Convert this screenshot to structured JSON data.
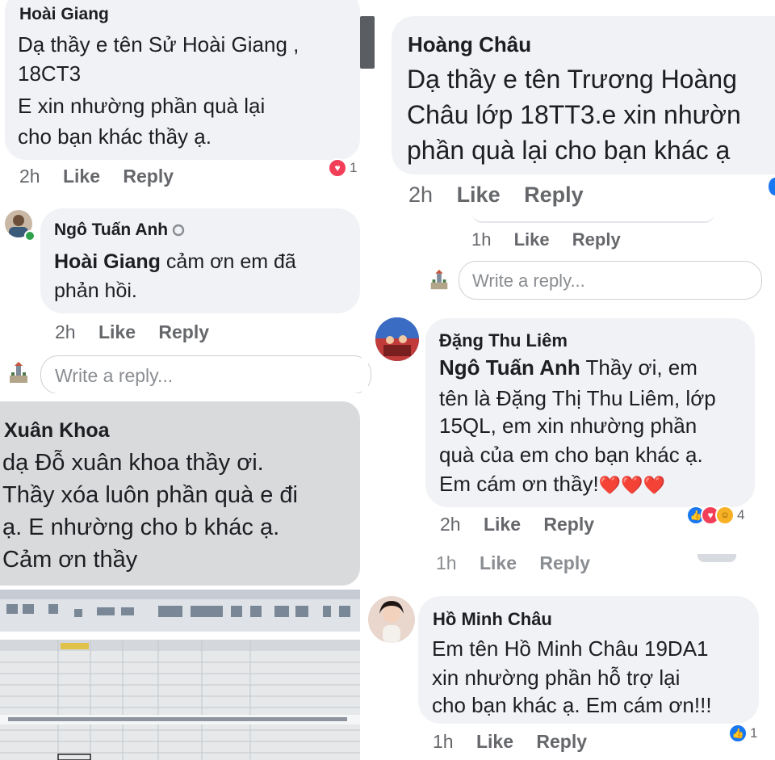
{
  "panel1": {
    "author": "Hoài Giang",
    "text_lines": [
      "Dạ thầy e tên Sử Hoài Giang ,",
      "18CT3",
      "E xin nhường phần quà lại",
      "cho bạn khác thầy ạ."
    ],
    "time": "2h",
    "like": "Like",
    "reply": "Reply",
    "reaction_count": "1",
    "reply_comment": {
      "author": "Ngô Tuấn Anh",
      "mention": "Hoài Giang",
      "text_line1": " cảm ơn em đã",
      "text_line2": "phản hồi.",
      "time": "2h",
      "like": "Like",
      "reply": "Reply"
    },
    "write_reply_placeholder": "Write a reply..."
  },
  "panel2": {
    "author": "Xuân Khoa",
    "text_lines": [
      "dạ Đỗ xuân khoa thầy ơi.",
      "Thầy xóa luôn phần quà e đi",
      "ạ. E nhường cho b khác ạ.",
      "Cảm ơn thầy"
    ]
  },
  "panel3": {
    "author": "Hoàng Châu",
    "text_lines": [
      "Dạ thầy e tên Trương Hoàng",
      "Châu lớp 18TT3.e xin nhườn",
      "phần quà lại cho bạn khác ạ"
    ],
    "time": "2h",
    "like": "Like",
    "reply": "Reply",
    "sub_meta": {
      "time": "1h",
      "like": "Like",
      "reply": "Reply"
    },
    "write_reply_placeholder": "Write a reply..."
  },
  "panel4": {
    "author": "Đặng Thu Liêm",
    "mention": "Ngô Tuấn Anh",
    "text_line1": " Thầy ơi, em",
    "text_lines": [
      "tên là Đặng Thị Thu Liêm, lớp",
      "15QL, em xin nhường phần",
      "quà của em cho bạn khác ạ."
    ],
    "last_line": "Em cám ơn thầy!",
    "hearts": "❤️❤️❤️",
    "time": "2h",
    "like": "Like",
    "reply": "Reply",
    "reaction_count": "4",
    "cut_meta": {
      "time": "1h",
      "like": "Like",
      "reply": "Reply"
    }
  },
  "panel5": {
    "author": "Hồ Minh Châu",
    "text_lines": [
      "Em tên Hồ Minh Châu 19DA1",
      "xin nhường phần hỗ trợ lại",
      "cho bạn khác ạ. Em cám ơn!!!"
    ],
    "time": "1h",
    "like": "Like",
    "reply": "Reply",
    "reaction_count": "1"
  },
  "colors": {
    "bubble": "#f0f2f5",
    "meta_grey": "#65676b",
    "like_blue": "#1877f2",
    "heart_red": "#f33e58"
  }
}
